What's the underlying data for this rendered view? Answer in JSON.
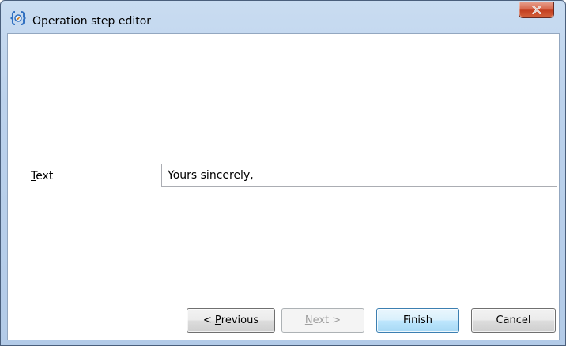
{
  "window": {
    "title": "Operation step editor",
    "icon": "operation-editor-app-icon",
    "close_icon": "close-icon"
  },
  "form": {
    "text_label_prefix": "",
    "text_label_mnemonic": "T",
    "text_label_rest": "ext",
    "text_value": "Yours sincerely,"
  },
  "buttons": {
    "previous_prefix": "< ",
    "previous_mnemonic": "P",
    "previous_rest": "revious",
    "next_mnemonic": "N",
    "next_rest": "ext >",
    "next_enabled": false,
    "finish": "Finish",
    "cancel": "Cancel"
  },
  "colors": {
    "titlebar": "#bcd2ec",
    "close_button": "#c94a2b",
    "default_button_border": "#3c7fb1"
  }
}
